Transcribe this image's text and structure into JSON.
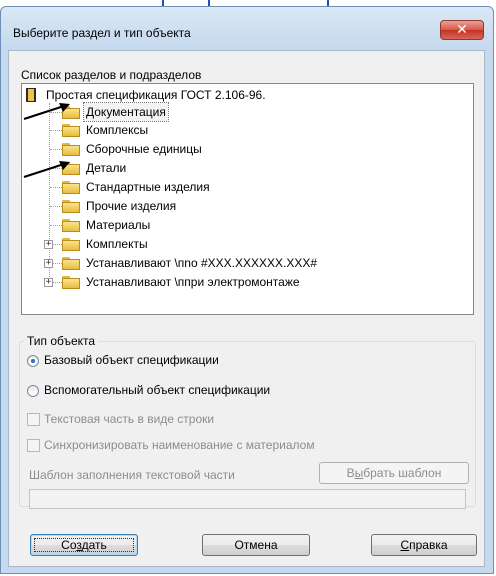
{
  "window": {
    "title": "Выберите раздел и тип объекта",
    "close_icon": "close-icon",
    "colors": {
      "selection_arrow": "#000000",
      "radio_selected": "#2a6fd6"
    }
  },
  "sections": {
    "label": "Список разделов и подразделов",
    "root": {
      "label": "Простая спецификация ГОСТ 2.106-96.",
      "icon": "book-icon"
    },
    "items": [
      {
        "label": "Документация",
        "selected": true,
        "expandable": false
      },
      {
        "label": "Комплексы",
        "expandable": false
      },
      {
        "label": "Сборочные единицы",
        "expandable": false
      },
      {
        "label": "Детали",
        "expandable": false
      },
      {
        "label": "Стандартные изделия",
        "expandable": false
      },
      {
        "label": "Прочие изделия",
        "expandable": false
      },
      {
        "label": "Материалы",
        "expandable": false
      },
      {
        "label": "Комплекты",
        "expandable": true
      },
      {
        "label": "Устанавливают \\пnо #XXX.XXXXXX.XXX#",
        "expandable": true
      },
      {
        "label": "Устанавливают \\ппри электромонтаже",
        "expandable": true
      }
    ]
  },
  "object_type": {
    "group_label": "Тип объекта",
    "options": [
      {
        "label": "Базовый объект спецификации",
        "selected": true
      },
      {
        "label": "Вспомогательный объект спецификации",
        "selected": false
      }
    ],
    "text_as_row": {
      "label": "Текстовая часть в виде строки",
      "checked": false,
      "enabled": false
    },
    "sync_name": {
      "label": "Синхронизировать наименование с материалом",
      "checked": false,
      "enabled": false
    },
    "template_label": "Шаблон заполнения текстовой части",
    "template_value": "",
    "choose_template": {
      "pre": "В",
      "acc": "ы",
      "post": "брать шаблон"
    }
  },
  "buttons": {
    "create": {
      "pre": "Со",
      "acc": "з",
      "post": "дать"
    },
    "cancel": "Отмена",
    "help": {
      "pre": "",
      "acc": "С",
      "post": "правка"
    }
  }
}
